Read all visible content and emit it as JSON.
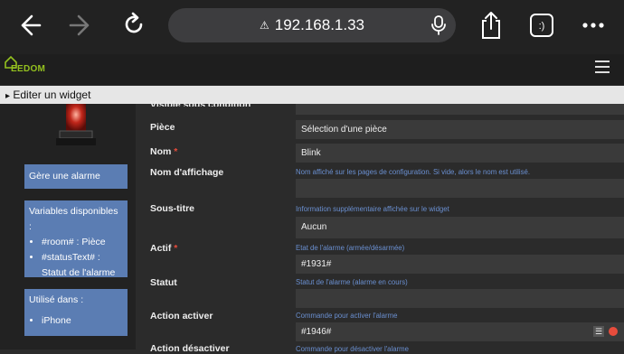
{
  "browser": {
    "url": "192.168.1.33"
  },
  "app": {
    "logo_text": "EEDOM"
  },
  "titlebar": {
    "label": "Editer un widget"
  },
  "sidebar": {
    "description": "Gère une alarme",
    "variables_title": "Variables disponibles :",
    "variables": [
      "#room# : Pièce",
      "#statusText# : Statut de l'alarme"
    ],
    "used_title": "Utilisé dans :",
    "used_in": [
      "iPhone"
    ]
  },
  "form": {
    "cut_label": "Visible sous condition",
    "piece_label": "Pièce",
    "piece_value": "Sélection d'une pièce",
    "nom_label": "Nom",
    "nom_value": "Blink",
    "affichage_label": "Nom d'affichage",
    "affichage_help": "Nom affiché sur les pages de configuration. Si vide, alors le nom est utilisé.",
    "soustitre_label": "Sous-titre",
    "soustitre_help": "Information supplémentaire affichée sur le widget",
    "soustitre_value": "Aucun",
    "actif_label": "Actif",
    "actif_help": "Etat de l'alarme (armée/désarmée)",
    "actif_value": "#1931#",
    "statut_label": "Statut",
    "statut_help": "Statut de l'alarme (alarme en cours)",
    "action_activer_label": "Action activer",
    "action_activer_help": "Commande pour activer l'alarme",
    "action_activer_value": "#1946#",
    "action_desactiver_label": "Action désactiver",
    "action_desactiver_help": "Commande pour désactiver l'alarme"
  },
  "colors": {
    "accent": "#94c11f",
    "info_box": "#5b7db3",
    "help_text": "#6a8fd0",
    "required": "#e74c3c"
  }
}
